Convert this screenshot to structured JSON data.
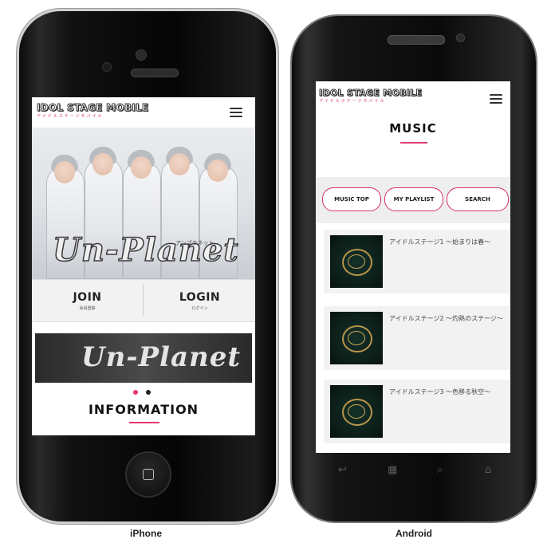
{
  "iphone": {
    "logo": {
      "main": "IDOL STAGE MOBILE",
      "sub": "アイドルステージモバイル"
    },
    "hero_title": "Un-Planet",
    "hero_kana": "アンプラネット",
    "join": {
      "label": "JOIN",
      "sub": "会員登録"
    },
    "login": {
      "label": "LOGIN",
      "sub": "ログイン"
    },
    "banner_title": "Un-Planet",
    "carousel": {
      "active_color": "#e23a6b",
      "inactive_color": "#222222"
    },
    "section_title": "INFORMATION",
    "caption": "iPhone"
  },
  "android": {
    "logo": {
      "main": "IDOL STAGE MOBILE",
      "sub": "アイドルステージモバイル"
    },
    "page_title": "MUSIC",
    "tabs": [
      {
        "label": "MUSIC TOP"
      },
      {
        "label": "MY PLAYLIST"
      },
      {
        "label": "SEARCH"
      }
    ],
    "tracks": [
      {
        "title": "アイドルステージ1 〜始まりは春〜"
      },
      {
        "title": "アイドルステージ2 〜灼熱のステージ〜"
      },
      {
        "title": "アイドルステージ3 〜色移る秋空〜"
      }
    ],
    "caption": "Android"
  },
  "colors": {
    "accent": "#e23a6b"
  },
  "icons": [
    "menu-icon",
    "back-icon",
    "home-icon",
    "search-icon",
    "recent-apps-icon",
    "home-button-icon"
  ]
}
